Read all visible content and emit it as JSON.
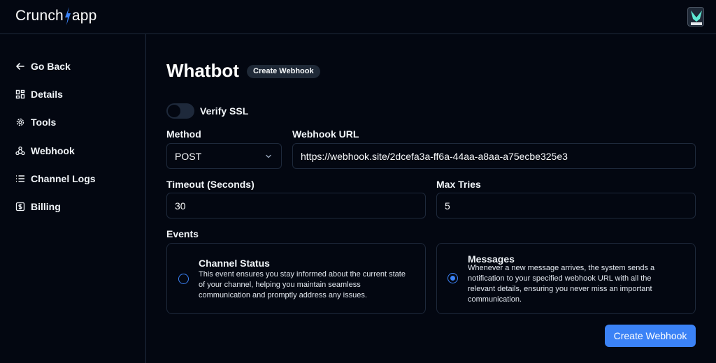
{
  "app": {
    "logo_left": "Crunch",
    "logo_right": "app",
    "brand_color": "#3b82f6"
  },
  "sidebar": {
    "items": [
      {
        "label": "Go Back",
        "icon": "arrow-left-icon"
      },
      {
        "label": "Details",
        "icon": "grid-icon"
      },
      {
        "label": "Tools",
        "icon": "gear-icon"
      },
      {
        "label": "Webhook",
        "icon": "webhook-icon"
      },
      {
        "label": "Channel Logs",
        "icon": "list-icon"
      },
      {
        "label": "Billing",
        "icon": "dollar-icon"
      }
    ]
  },
  "page": {
    "title": "Whatbot",
    "badge": "Create Webhook"
  },
  "form": {
    "verify_ssl": {
      "label": "Verify SSL",
      "enabled": false
    },
    "method": {
      "label": "Method",
      "value": "POST"
    },
    "webhook_url": {
      "label": "Webhook URL",
      "value": "https://webhook.site/2dcefa3a-ff6a-44aa-a8aa-a75ecbe325e3"
    },
    "timeout": {
      "label": "Timeout (Seconds)",
      "value": "30"
    },
    "max_tries": {
      "label": "Max Tries",
      "value": "5"
    },
    "events_label": "Events",
    "events": [
      {
        "title": "Channel Status",
        "description": "This event ensures you stay informed about the current state of your channel, helping you maintain seamless communication and promptly address any issues.",
        "selected": false
      },
      {
        "title": "Messages",
        "description": "Whenever a new message arrives, the system sends a notification to your specified webhook URL with all the relevant details, ensuring you never miss an important communication.",
        "selected": true
      }
    ],
    "submit_label": "Create Webhook"
  }
}
